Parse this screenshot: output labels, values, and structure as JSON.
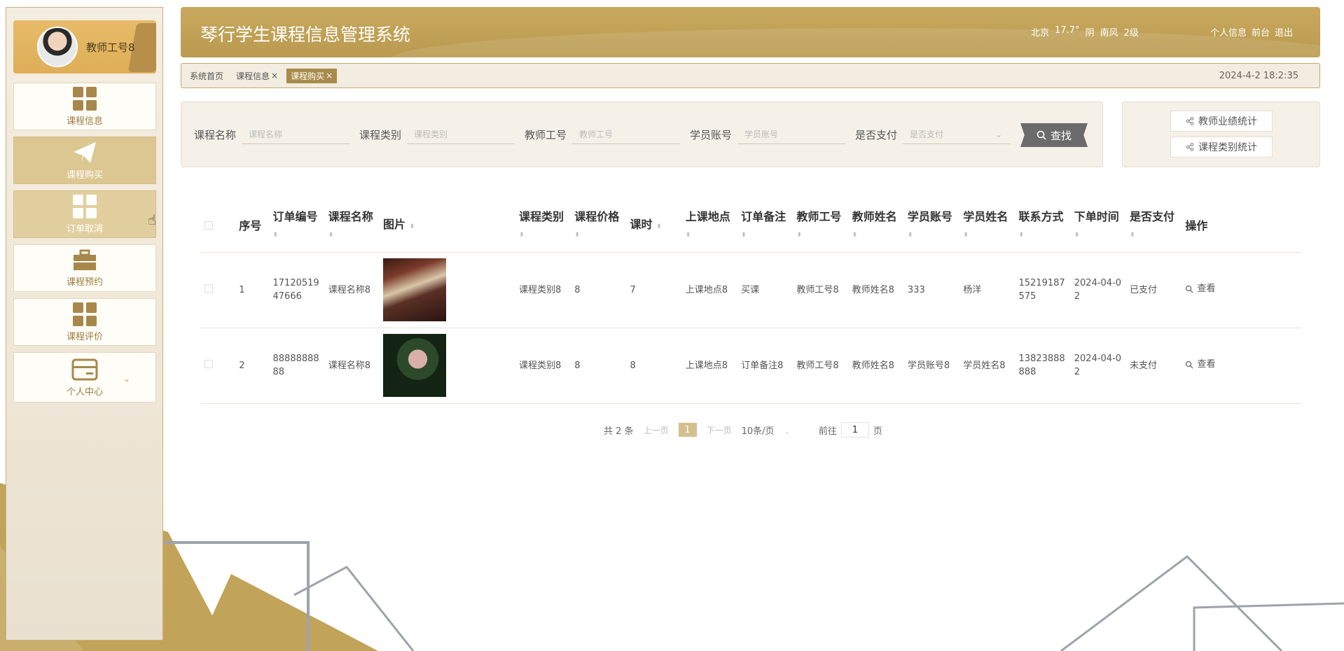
{
  "app": {
    "title": "琴行学生课程信息管理系统",
    "accent_color": "#c2a35a",
    "weather": {
      "city": "北京",
      "temp": "17.7°",
      "condition": "阴",
      "wind": "南风",
      "level": "2级"
    },
    "links": [
      "个人信息",
      "前台",
      "退出"
    ]
  },
  "sidebar": {
    "user_name": "教师工号8",
    "items": [
      {
        "label": "课程信息",
        "icon": "grid-icon"
      },
      {
        "label": "课程购买",
        "icon": "paper-plane-icon"
      },
      {
        "label": "订单取消",
        "icon": "grid-icon"
      },
      {
        "label": "课程预约",
        "icon": "briefcase-icon"
      },
      {
        "label": "课程评价",
        "icon": "grid-icon"
      },
      {
        "label": "个人中心",
        "icon": "card-icon"
      }
    ]
  },
  "tabs": {
    "items": [
      {
        "label": "系统首页",
        "closable": false
      },
      {
        "label": "课程信息",
        "closable": true
      },
      {
        "label": "课程购买",
        "closable": true
      }
    ],
    "clock": "2024-4-2 18:2:35"
  },
  "search": {
    "fields": [
      {
        "label": "课程名称",
        "placeholder": "课程名称"
      },
      {
        "label": "课程类别",
        "placeholder": "课程类别"
      },
      {
        "label": "教师工号",
        "placeholder": "教师工号"
      },
      {
        "label": "学员账号",
        "placeholder": "学员账号"
      },
      {
        "label": "是否支付",
        "placeholder": "是否支付"
      }
    ],
    "button_label": "查找"
  },
  "stats": {
    "buttons": [
      "教师业绩统计",
      "课程类别统计"
    ]
  },
  "table": {
    "headers": [
      "序号",
      "订单编号",
      "课程名称",
      "图片",
      "课程类别",
      "课程价格",
      "课时",
      "上课地点",
      "订单备注",
      "教师工号",
      "教师姓名",
      "学员账号",
      "学员姓名",
      "联系方式",
      "下单时间",
      "是否支付",
      "操作"
    ],
    "rows": [
      [
        "1",
        "1712051947666",
        "课程名称8",
        "",
        "课程类别8",
        "8",
        "7",
        "上课地点8",
        "买课",
        "教师工号8",
        "教师姓名8",
        "333",
        "杨洋",
        "15219187575",
        "2024-04-02",
        "已支付",
        "查看"
      ],
      [
        "2",
        "8888888888",
        "课程名称8",
        "",
        "课程类别8",
        "8",
        "8",
        "上课地点8",
        "订单备注8",
        "教师工号8",
        "教师姓名8",
        "学员账号8",
        "学员姓名8",
        "13823888888",
        "2024-04-02",
        "未支付",
        "查看"
      ]
    ]
  },
  "pagination": {
    "total": "共 2 条",
    "prev": "上一页",
    "current": "1",
    "next": "下一页",
    "page_size": "10条/页",
    "goto_label": "前往",
    "goto_value": "1",
    "page_suffix": "页"
  }
}
